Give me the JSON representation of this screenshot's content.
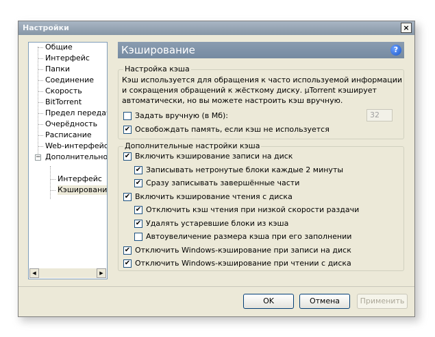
{
  "window": {
    "title": "Настройки",
    "close_label": "×"
  },
  "tree": {
    "items": [
      {
        "label": "Общие"
      },
      {
        "label": "Интерфейс"
      },
      {
        "label": "Папки"
      },
      {
        "label": "Соединение"
      },
      {
        "label": "Скорость"
      },
      {
        "label": "BitTorrent"
      },
      {
        "label": "Предел передачи"
      },
      {
        "label": "Очерёдность"
      },
      {
        "label": "Расписание"
      },
      {
        "label": "Web-интерфейс"
      },
      {
        "label": "Дополнительно",
        "expanded": true,
        "expander": "−"
      },
      {
        "label": "Интерфейс",
        "child": true
      },
      {
        "label": "Кэширование",
        "child": true,
        "selected": true
      }
    ],
    "scroll_left": "◀",
    "scroll_right": "▶"
  },
  "panel": {
    "title": "Кэширование",
    "help_label": "?",
    "group1": {
      "label": "Настройка кэша",
      "description": "Кэш используется для обращения к часто используемой информации и сокращения обращений к жёсткому диску. µTorrent кэширует автоматически, но вы можете настроить кэш вручную.",
      "manual_label": "Задать вручную (в Мб):",
      "manual_checked": false,
      "manual_value": "32",
      "free_memory_label": "Освобождать память, если кэш не используется",
      "free_memory_checked": true
    },
    "group2": {
      "label": "Дополнительные настройки кэша",
      "options": [
        {
          "label": "Включить кэширование записи на диск",
          "checked": true,
          "indent": 0
        },
        {
          "label": "Записывать нетронутые блоки каждые 2 минуты",
          "checked": true,
          "indent": 1
        },
        {
          "label": "Сразу записывать завершённые части",
          "checked": true,
          "indent": 1
        },
        {
          "label": "Включить кэширование чтения с диска",
          "checked": true,
          "indent": 0
        },
        {
          "label": "Отключить кэш чтения при низкой скорости раздачи",
          "checked": true,
          "indent": 1
        },
        {
          "label": "Удалять устаревшие блоки из кэша",
          "checked": true,
          "indent": 1
        },
        {
          "label": "Автоувеличение размера кэша при его заполнении",
          "checked": false,
          "indent": 1
        },
        {
          "label": "Отключить Windows-кэширование при записи на диск",
          "checked": true,
          "indent": 0
        },
        {
          "label": "Отключить Windows-кэширование при чтении с диска",
          "checked": true,
          "indent": 0
        }
      ]
    }
  },
  "buttons": {
    "ok": "OK",
    "cancel": "Отмена",
    "apply": "Применить"
  },
  "check_mark": "✔"
}
